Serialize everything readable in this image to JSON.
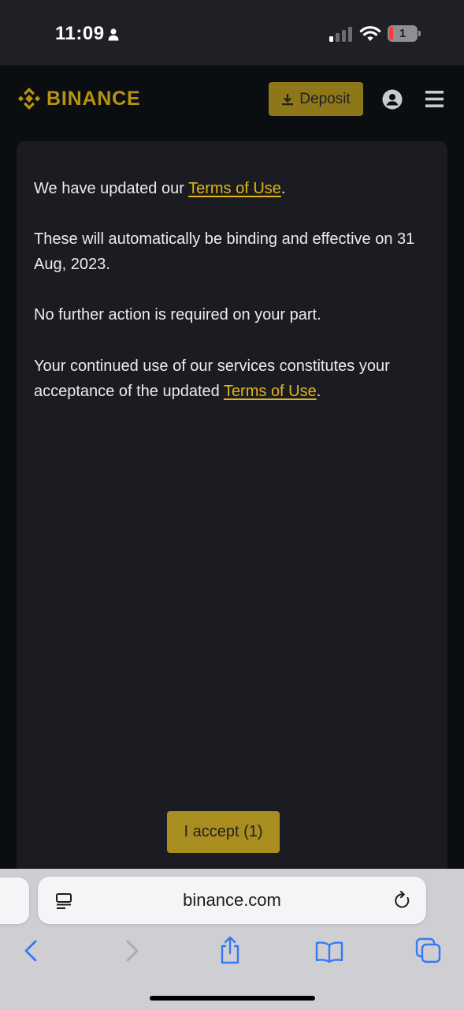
{
  "status_bar": {
    "time": "11:09",
    "battery_level": "1",
    "icons": [
      "person-icon",
      "signal-icon",
      "wifi-icon",
      "battery-icon"
    ]
  },
  "header": {
    "logo_text": "BINANCE",
    "deposit_label": "Deposit",
    "icons": [
      "binance-logo-icon",
      "download-icon",
      "account-icon",
      "menu-icon"
    ]
  },
  "dialog": {
    "p1_before": "We have updated our ",
    "p1_link": "Terms of Use",
    "p1_after": ".",
    "p2": "These will automatically be binding and effective on 31 Aug, 2023.",
    "p3": "No further action is required on your part.",
    "p4_before": "Your continued use of our services constitutes your acceptance of the updated ",
    "p4_link": "Terms of Use",
    "p4_after": ".",
    "accept_label": "I accept (1)"
  },
  "browser": {
    "url": "binance.com",
    "icons": [
      "reader-icon",
      "reload-icon",
      "back-icon",
      "forward-icon",
      "share-icon",
      "bookmarks-icon",
      "tabs-icon"
    ]
  },
  "colors": {
    "brand": "#b7930f",
    "link": "#e0b41b",
    "accept_button": "#a98d1f",
    "deposit_button": "#8d7718",
    "dialog_bg": "#1b1c21",
    "page_bg": "#0b0e11",
    "safari_blue": "#3478f6"
  }
}
